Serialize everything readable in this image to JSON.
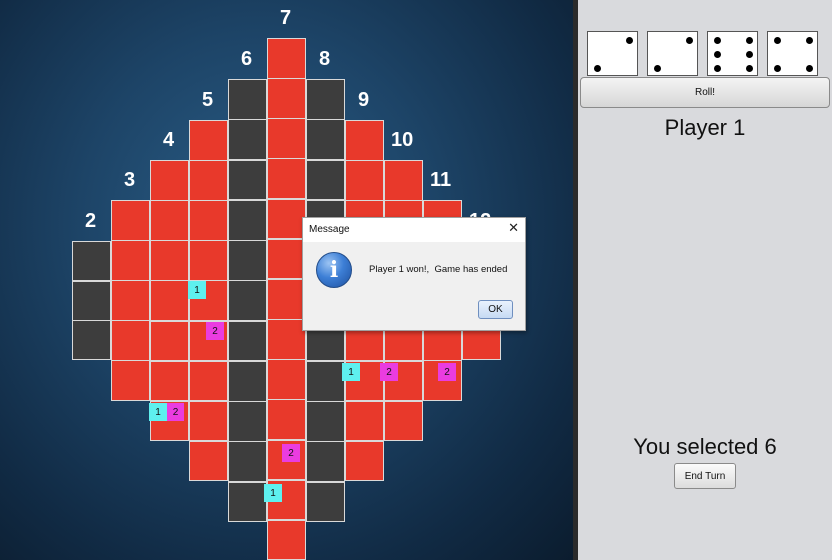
{
  "board": {
    "column_numbers": [
      "2",
      "3",
      "4",
      "5",
      "6",
      "7",
      "8",
      "9",
      "10",
      "11",
      "12"
    ],
    "markers": [
      {
        "label": "1",
        "player": 1
      },
      {
        "label": "2",
        "player": 2
      },
      {
        "label": "1",
        "player": 1
      },
      {
        "label": "2",
        "player": 2
      },
      {
        "label": "1",
        "player": 1
      },
      {
        "label": "1",
        "player": 1
      },
      {
        "label": "2",
        "player": 2
      },
      {
        "label": "1",
        "player": 1
      },
      {
        "label": "2",
        "player": 2
      },
      {
        "label": "2",
        "player": 2
      }
    ],
    "colors": {
      "red": "#e8392b",
      "gray": "#3d3d3d",
      "player1": "#5ef0ef",
      "player2": "#ea3ce0"
    }
  },
  "dice": [
    {
      "value": 2
    },
    {
      "value": 2
    },
    {
      "value": 6
    },
    {
      "value": 4
    }
  ],
  "controls": {
    "roll_label": "Roll!",
    "player_label": "Player 1",
    "selected_label": "You selected 6",
    "end_turn_label": "End Turn"
  },
  "dialog": {
    "title": "Message",
    "close_icon": "close-icon",
    "icon": "info-icon",
    "icon_glyph": "i",
    "message": "Player 1 won!,  Game has ended",
    "ok_label": "OK"
  }
}
